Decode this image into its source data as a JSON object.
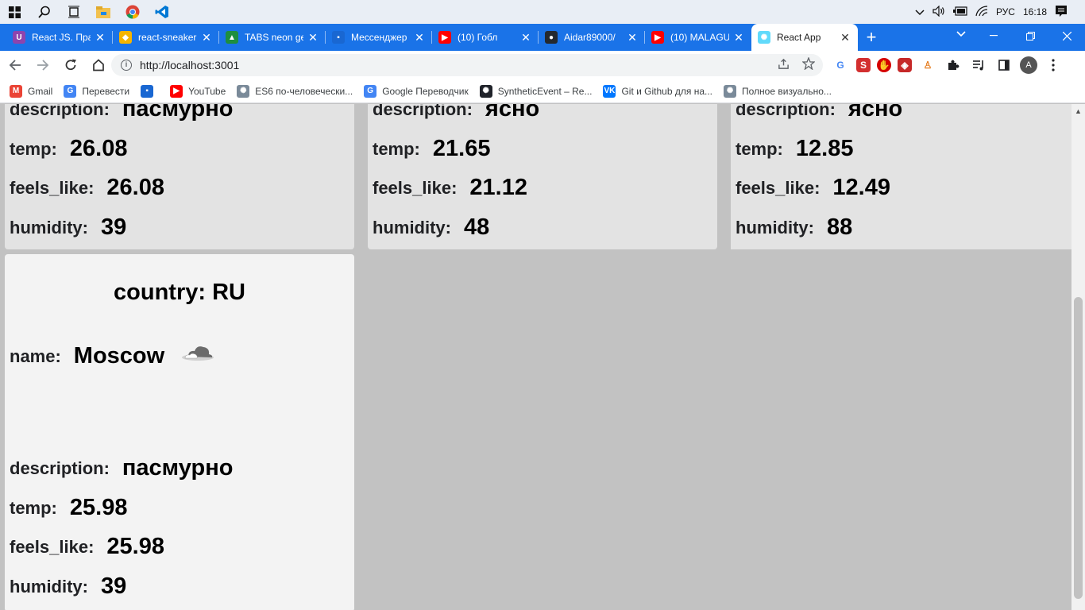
{
  "taskbar": {
    "icons": [
      "windows-icon",
      "search-icon",
      "task-view-icon",
      "file-explorer-icon",
      "chrome-icon",
      "vscode-icon"
    ],
    "tray": {
      "chevron": "^",
      "volume": "🔊",
      "battery": "▭",
      "wifi": "◔",
      "language": "РУС",
      "time": "16:18",
      "notifications": "▤"
    }
  },
  "browser": {
    "tabs": [
      {
        "title": "React JS. Пра",
        "fav_text": "U",
        "fav_color": "#8e44ad"
      },
      {
        "title": "react-sneaker",
        "fav_text": "◆",
        "fav_color": "#f5b400"
      },
      {
        "title": "TABS neon ge",
        "fav_text": "▲",
        "fav_color": "#1e8e3e"
      },
      {
        "title": "Мессенджер",
        "fav_text": "▪",
        "fav_color": "#1967d2"
      },
      {
        "title": "(10) Гобл",
        "fav_text": "▶",
        "fav_color": "#ff0000"
      },
      {
        "title": "Aidar89000/",
        "fav_text": "●",
        "fav_color": "#24292f"
      },
      {
        "title": "(10) MALAGU",
        "fav_text": "▶",
        "fav_color": "#ff0000"
      },
      {
        "title": "React App",
        "fav_text": "✺",
        "fav_color": "#61dafb"
      }
    ],
    "active_tab_index": 7,
    "new_tab_label": "+",
    "close_label": "✕",
    "url": "http://localhost:3001",
    "bookmarks": [
      {
        "label": "Gmail",
        "icon": "M",
        "color": "#ea4335"
      },
      {
        "label": "Перевести",
        "icon": "G",
        "color": "#4285f4"
      },
      {
        "label": "",
        "icon": "▪",
        "color": "#1967d2"
      },
      {
        "label": "YouTube",
        "icon": "▶",
        "color": "#ff0000"
      },
      {
        "label": "ES6 по-человечески...",
        "icon": "✺",
        "color": "#7a8a99"
      },
      {
        "label": "Google Переводчик",
        "icon": "G",
        "color": "#4285f4"
      },
      {
        "label": "SyntheticEvent – Re...",
        "icon": "✺",
        "color": "#20232a"
      },
      {
        "label": "Git и Github для на...",
        "icon": "VK",
        "color": "#0077ff"
      },
      {
        "label": "Полное визуально...",
        "icon": "✺",
        "color": "#7a8a99"
      }
    ]
  },
  "cards_top": [
    {
      "description": "пасмурно",
      "temp": "26.08",
      "feels_like": "26.08",
      "humidity": "39"
    },
    {
      "description": "ясно",
      "temp": "21.65",
      "feels_like": "21.12",
      "humidity": "48"
    },
    {
      "description": "ясно",
      "temp": "12.85",
      "feels_like": "12.49",
      "humidity": "88"
    }
  ],
  "card_full": {
    "country": "country: RU",
    "name_label": "name:",
    "name": "Moscow",
    "weather_icon": "☁",
    "description": "пасмурно",
    "temp": "25.98",
    "feels_like": "25.98",
    "humidity": "39"
  },
  "labels": {
    "description": "description:",
    "temp": "temp:",
    "feels_like": "feels_like:",
    "humidity": "humidity:"
  }
}
